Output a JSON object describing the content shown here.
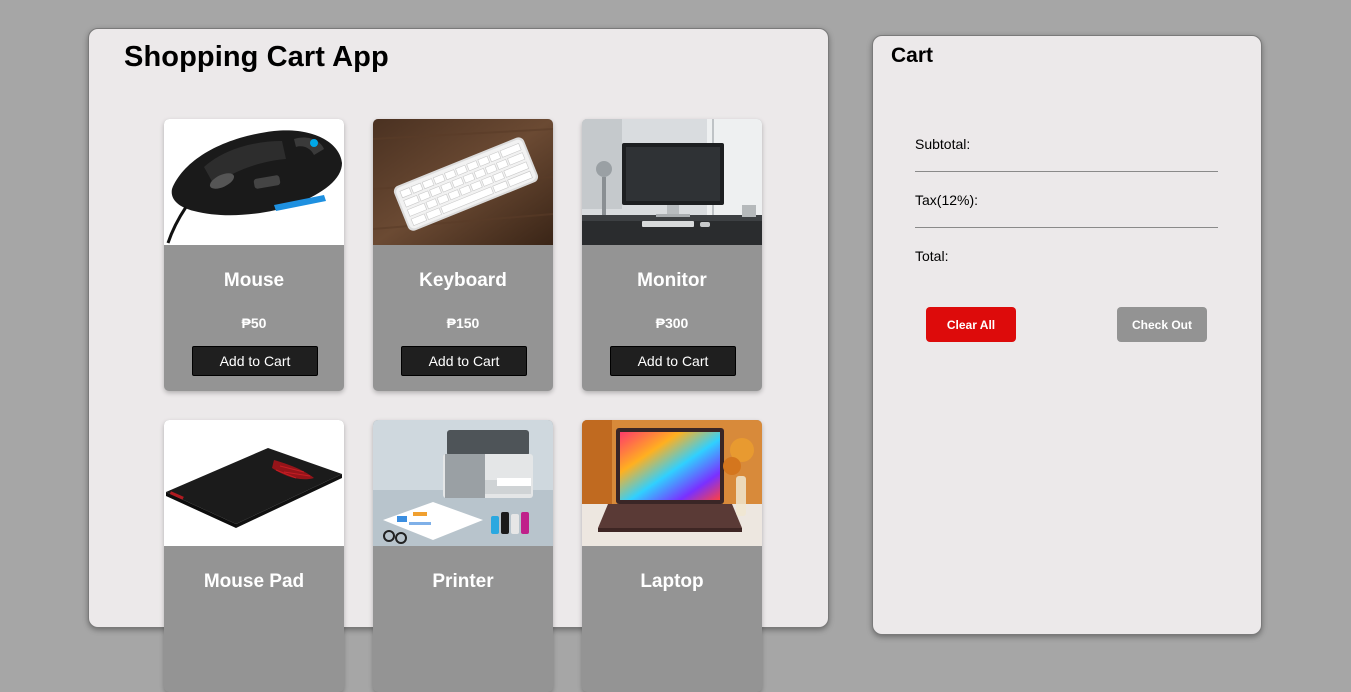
{
  "app": {
    "title": "Shopping Cart App"
  },
  "products": [
    {
      "name": "Mouse",
      "price": "₱50",
      "button_label": "Add to Cart",
      "image": "gaming-mouse-photo"
    },
    {
      "name": "Keyboard",
      "price": "₱150",
      "button_label": "Add to Cart",
      "image": "keyboard-photo"
    },
    {
      "name": "Monitor",
      "price": "₱300",
      "button_label": "Add to Cart",
      "image": "monitor-photo"
    },
    {
      "name": "Mouse Pad",
      "price": "",
      "button_label": "",
      "image": "mouse-pad-photo"
    },
    {
      "name": "Printer",
      "price": "",
      "button_label": "",
      "image": "printer-photo"
    },
    {
      "name": "Laptop",
      "price": "",
      "button_label": "",
      "image": "laptop-photo"
    }
  ],
  "cart": {
    "title": "Cart",
    "subtotal_label": "Subtotal:",
    "tax_label": "Tax(12%):",
    "total_label": "Total:",
    "clear_label": "Clear All",
    "checkout_label": "Check Out"
  },
  "colors": {
    "page_background": "#a6a6a6",
    "panel_background": "#ece9ea",
    "card_background": "#949494",
    "add_button": "#1f1f1f",
    "clear_button": "#dd0b0b",
    "checkout_button": "#939393"
  }
}
